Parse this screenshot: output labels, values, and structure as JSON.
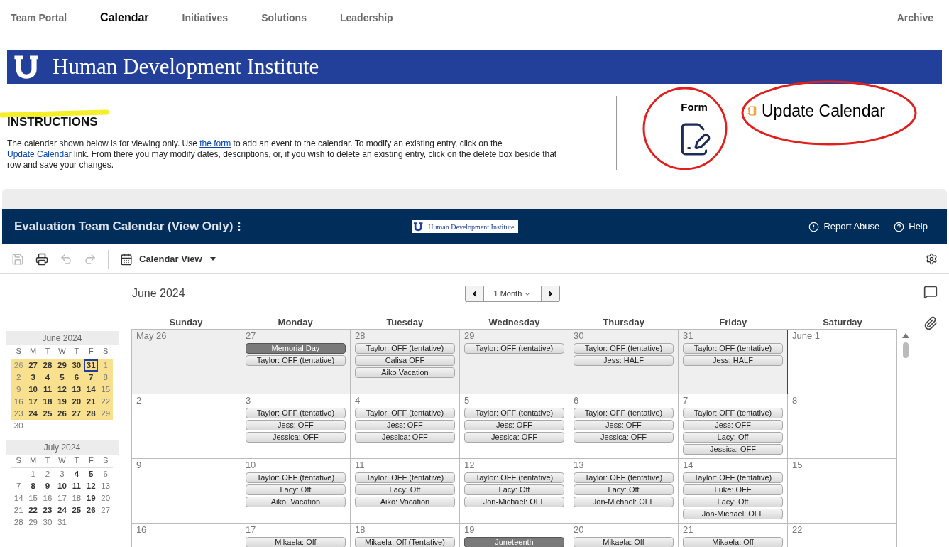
{
  "nav": {
    "items": [
      {
        "label": "Team Portal",
        "selected": false
      },
      {
        "label": "Calendar",
        "selected": true
      },
      {
        "label": "Initiatives",
        "selected": false
      },
      {
        "label": "Solutions",
        "selected": false
      },
      {
        "label": "Leadership",
        "selected": false
      }
    ],
    "right_item": "Archive"
  },
  "banner": {
    "title": "Human Development Institute"
  },
  "instructions": {
    "heading": "INSTRUCTIONS",
    "paragraph": [
      {
        "kind": "text",
        "text": "The calendar shown below is for viewing only. Use "
      },
      {
        "kind": "link",
        "text": "the form"
      },
      {
        "kind": "text",
        "text": " to add an event to the calendar. To modify an existing entry, click on the "
      },
      {
        "kind": "link",
        "text": "Update Calendar"
      },
      {
        "kind": "text",
        "text": " link. From there you may modify dates, descriptions, or, if you wish to delete an existing entry, click on the delete box beside that row and save your changes."
      }
    ]
  },
  "form_link": {
    "label": "Form"
  },
  "update_link": {
    "label": "Update Calendar"
  },
  "app_header": {
    "title": "Evaluation Team Calendar (View Only)",
    "logo_text": "Human Development Institute",
    "actions": [
      "Report Abuse",
      "Help"
    ]
  },
  "toolbar": {
    "save_disabled": true,
    "undo_disabled": true,
    "redo_disabled": true,
    "view_label": "Calendar View"
  },
  "calendar": {
    "month_title": "June 2024",
    "range": "1 Month",
    "weekdays": [
      "Sunday",
      "Monday",
      "Tuesday",
      "Wednesday",
      "Thursday",
      "Friday",
      "Saturday"
    ],
    "weeks": [
      [
        {
          "date": "May 26",
          "shaded": true,
          "today": false
        },
        {
          "date": "27",
          "shaded": true,
          "today": false,
          "events": [
            {
              "kind": "holiday",
              "text": "Memorial Day"
            },
            {
              "kind": "regular",
              "text": "Taylor: OFF (tentative)"
            }
          ]
        },
        {
          "date": "28",
          "shaded": true,
          "today": false,
          "events": [
            {
              "kind": "regular",
              "text": "Taylor: OFF (tentative)"
            },
            {
              "kind": "regular",
              "text": "Calisa OFF"
            },
            {
              "kind": "regular",
              "text": "Aiko Vacation"
            }
          ]
        },
        {
          "date": "29",
          "shaded": true,
          "today": false,
          "events": [
            {
              "kind": "regular",
              "text": "Taylor: OFF (tentative)"
            }
          ]
        },
        {
          "date": "30",
          "shaded": true,
          "today": false,
          "events": [
            {
              "kind": "regular",
              "text": "Taylor: OFF (tentative)"
            },
            {
              "kind": "regular",
              "text": "Jess: HALF"
            }
          ]
        },
        {
          "date": "31",
          "shaded": true,
          "today": true,
          "events": [
            {
              "kind": "regular",
              "text": "Taylor: OFF (tentative)"
            },
            {
              "kind": "regular",
              "text": "Jess: HALF"
            }
          ]
        },
        {
          "date": "June 1",
          "shaded": false,
          "today": false
        }
      ],
      [
        {
          "date": "2",
          "shaded": false,
          "today": false
        },
        {
          "date": "3",
          "shaded": false,
          "today": false,
          "events": [
            {
              "kind": "regular",
              "text": "Taylor: OFF (tentative)"
            },
            {
              "kind": "regular",
              "text": "Jess: OFF"
            },
            {
              "kind": "regular",
              "text": "Jessica: OFF"
            }
          ]
        },
        {
          "date": "4",
          "shaded": false,
          "today": false,
          "events": [
            {
              "kind": "regular",
              "text": "Taylor: OFF (tentative)"
            },
            {
              "kind": "regular",
              "text": "Jess: OFF"
            },
            {
              "kind": "regular",
              "text": "Jessica: OFF"
            }
          ]
        },
        {
          "date": "5",
          "shaded": false,
          "today": false,
          "events": [
            {
              "kind": "regular",
              "text": "Taylor: OFF (tentative)"
            },
            {
              "kind": "regular",
              "text": "Jess: OFF"
            },
            {
              "kind": "regular",
              "text": "Jessica: OFF"
            }
          ]
        },
        {
          "date": "6",
          "shaded": false,
          "today": false,
          "events": [
            {
              "kind": "regular",
              "text": "Taylor: OFF (tentative)"
            },
            {
              "kind": "regular",
              "text": "Jess: OFF"
            },
            {
              "kind": "regular",
              "text": "Jessica: OFF"
            }
          ]
        },
        {
          "date": "7",
          "shaded": false,
          "today": false,
          "events": [
            {
              "kind": "regular",
              "text": "Taylor: OFF (tentative)"
            },
            {
              "kind": "regular",
              "text": "Jess: OFF"
            },
            {
              "kind": "regular",
              "text": "Lacy: Off"
            },
            {
              "kind": "regular",
              "text": "Jessica: OFF"
            }
          ]
        },
        {
          "date": "8",
          "shaded": false,
          "today": false
        }
      ],
      [
        {
          "date": "9",
          "shaded": false,
          "today": false
        },
        {
          "date": "10",
          "shaded": false,
          "today": false,
          "events": [
            {
              "kind": "regular",
              "text": "Taylor: OFF (tentative)"
            },
            {
              "kind": "regular",
              "text": "Lacy: Off"
            },
            {
              "kind": "regular",
              "text": "Aiko: Vacation"
            }
          ]
        },
        {
          "date": "11",
          "shaded": false,
          "today": false,
          "events": [
            {
              "kind": "regular",
              "text": "Taylor: OFF (tentative)"
            },
            {
              "kind": "regular",
              "text": "Lacy: Off"
            },
            {
              "kind": "regular",
              "text": "Aiko: Vacation"
            }
          ]
        },
        {
          "date": "12",
          "shaded": false,
          "today": false,
          "events": [
            {
              "kind": "regular",
              "text": "Taylor: OFF (tentative)"
            },
            {
              "kind": "regular",
              "text": "Lacy: Off"
            },
            {
              "kind": "regular",
              "text": "Jon-Michael: OFF"
            }
          ]
        },
        {
          "date": "13",
          "shaded": false,
          "today": false,
          "events": [
            {
              "kind": "regular",
              "text": "Taylor: OFF (tentative)"
            },
            {
              "kind": "regular",
              "text": "Lacy: Off"
            },
            {
              "kind": "regular",
              "text": "Jon-Michael: OFF"
            }
          ]
        },
        {
          "date": "14",
          "shaded": false,
          "today": false,
          "events": [
            {
              "kind": "regular",
              "text": "Taylor: OFF (tentative)"
            },
            {
              "kind": "regular",
              "text": "Luke: OFF"
            },
            {
              "kind": "regular",
              "text": "Lacy: Off"
            },
            {
              "kind": "regular",
              "text": "Jon-Michael: OFF"
            }
          ]
        },
        {
          "date": "15",
          "shaded": false,
          "today": false
        }
      ],
      [
        {
          "date": "16",
          "shaded": false,
          "today": false
        },
        {
          "date": "17",
          "shaded": false,
          "today": false,
          "events": [
            {
              "kind": "regular",
              "text": "Mikaela: Off"
            }
          ]
        },
        {
          "date": "18",
          "shaded": false,
          "today": false,
          "events": [
            {
              "kind": "regular",
              "text": "Mikaela: Off (Tentative)"
            }
          ]
        },
        {
          "date": "19",
          "shaded": false,
          "today": false,
          "events": [
            {
              "kind": "holiday",
              "text": "Juneteenth"
            }
          ]
        },
        {
          "date": "20",
          "shaded": false,
          "today": false,
          "events": [
            {
              "kind": "regular",
              "text": "Mikaela: Off"
            }
          ]
        },
        {
          "date": "21",
          "shaded": false,
          "today": false,
          "events": [
            {
              "kind": "regular",
              "text": "Mikaela: Off"
            }
          ]
        },
        {
          "date": "22",
          "shaded": false,
          "today": false
        }
      ]
    ]
  },
  "mini_calendars": [
    {
      "title": "June 2024",
      "weekdays": [
        "S",
        "M",
        "T",
        "W",
        "T",
        "F",
        "S"
      ],
      "weeks": [
        {
          "highlighted": true,
          "days": [
            {
              "d": "26",
              "other_month": true
            },
            {
              "d": "27",
              "bold": true
            },
            {
              "d": "28",
              "bold": true
            },
            {
              "d": "29",
              "bold": true
            },
            {
              "d": "30",
              "bold": true
            },
            {
              "d": "31",
              "bold": true,
              "today": true
            },
            {
              "d": "1",
              "other_month": true
            }
          ]
        },
        {
          "highlighted": true,
          "days": [
            {
              "d": "2"
            },
            {
              "d": "3",
              "bold": true
            },
            {
              "d": "4",
              "bold": true
            },
            {
              "d": "5",
              "bold": true
            },
            {
              "d": "6",
              "bold": true
            },
            {
              "d": "7",
              "bold": true
            },
            {
              "d": "8"
            }
          ]
        },
        {
          "highlighted": true,
          "days": [
            {
              "d": "9"
            },
            {
              "d": "10",
              "bold": true
            },
            {
              "d": "11",
              "bold": true
            },
            {
              "d": "12",
              "bold": true
            },
            {
              "d": "13",
              "bold": true
            },
            {
              "d": "14",
              "bold": true
            },
            {
              "d": "15"
            }
          ]
        },
        {
          "highlighted": true,
          "days": [
            {
              "d": "16"
            },
            {
              "d": "17",
              "bold": true
            },
            {
              "d": "18",
              "bold": true
            },
            {
              "d": "19",
              "bold": true
            },
            {
              "d": "20",
              "bold": true
            },
            {
              "d": "21",
              "bold": true
            },
            {
              "d": "22"
            }
          ]
        },
        {
          "highlighted": true,
          "days": [
            {
              "d": "23"
            },
            {
              "d": "24",
              "bold": true
            },
            {
              "d": "25",
              "bold": true
            },
            {
              "d": "26",
              "bold": true
            },
            {
              "d": "27",
              "bold": true
            },
            {
              "d": "28",
              "bold": true
            },
            {
              "d": "29"
            }
          ]
        },
        {
          "highlighted": false,
          "days": [
            {
              "d": "30"
            }
          ]
        }
      ]
    },
    {
      "title": "July 2024",
      "weekdays": [
        "S",
        "M",
        "T",
        "W",
        "T",
        "F",
        "S"
      ],
      "weeks": [
        {
          "highlighted": false,
          "kind": "leading",
          "days": [
            {
              "d": "1"
            },
            {
              "d": "2"
            },
            {
              "d": "3"
            },
            {
              "d": "4",
              "bold": true
            },
            {
              "d": "5",
              "bold": true
            },
            {
              "d": "6"
            }
          ]
        },
        {
          "highlighted": false,
          "days": [
            {
              "d": "7"
            },
            {
              "d": "8",
              "bold": true
            },
            {
              "d": "9",
              "bold": true
            },
            {
              "d": "10",
              "bold": true
            },
            {
              "d": "11",
              "bold": true
            },
            {
              "d": "12",
              "bold": true
            },
            {
              "d": "13"
            }
          ]
        },
        {
          "highlighted": false,
          "days": [
            {
              "d": "14"
            },
            {
              "d": "15"
            },
            {
              "d": "16"
            },
            {
              "d": "17"
            },
            {
              "d": "18"
            },
            {
              "d": "19",
              "bold": true
            },
            {
              "d": "20"
            }
          ]
        },
        {
          "highlighted": false,
          "days": [
            {
              "d": "21"
            },
            {
              "d": "22",
              "bold": true
            },
            {
              "d": "23",
              "bold": true
            },
            {
              "d": "24",
              "bold": true
            },
            {
              "d": "25",
              "bold": true
            },
            {
              "d": "26",
              "bold": true
            },
            {
              "d": "27"
            }
          ]
        },
        {
          "highlighted": false,
          "days": [
            {
              "d": "28"
            },
            {
              "d": "29"
            },
            {
              "d": "30"
            },
            {
              "d": "31"
            }
          ]
        }
      ]
    }
  ]
}
